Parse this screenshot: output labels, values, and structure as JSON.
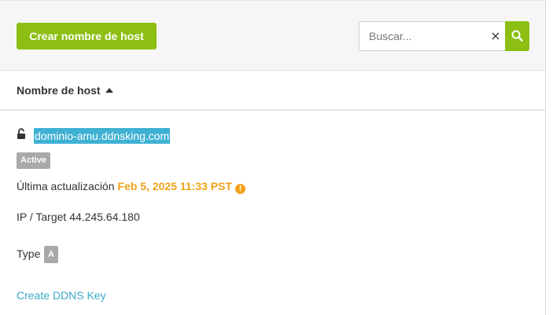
{
  "toolbar": {
    "create_label": "Crear nombre de host",
    "search_placeholder": "Buscar...",
    "search_value": "",
    "clear_icon": "×",
    "accent_color": "#8cbf12"
  },
  "table": {
    "column_header": "Nombre de host",
    "sort_direction": "ascending"
  },
  "host": {
    "name": "dominio-amu.ddnsking.com",
    "locked": false,
    "status": "Active",
    "last_update_label": "Última actualización",
    "last_update_value": "Feb 5, 2025 11:33 PST",
    "warning_glyph": "!",
    "ip_label": "IP / Target",
    "ip_value": "44.245.64.180",
    "type_label": "Type",
    "type_value": "A",
    "ddns_link": "Create DDNS Key"
  },
  "colors": {
    "highlight": "#3fb1d3",
    "warning": "#f0a21a",
    "link": "#3aa9c8",
    "badge": "#a9a9a9"
  }
}
